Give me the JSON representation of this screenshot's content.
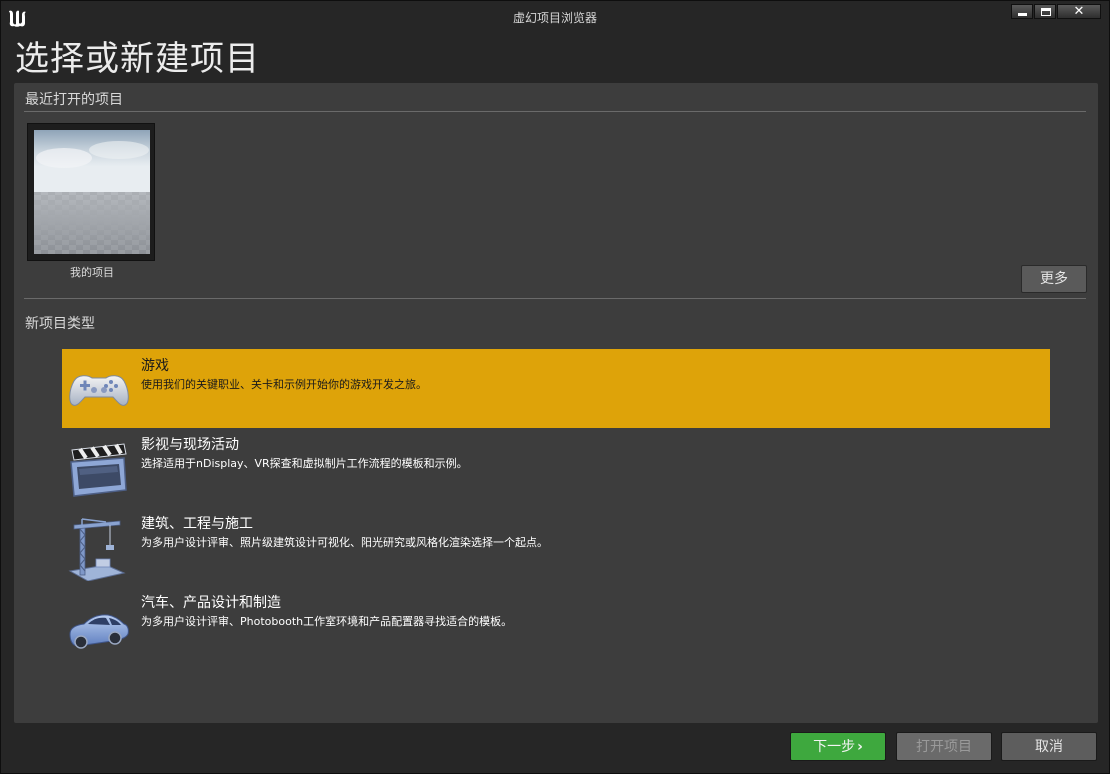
{
  "window": {
    "title": "虚幻项目浏览器",
    "logo_icon": "unreal-logo-icon",
    "controls": [
      "minimize",
      "maximize",
      "close"
    ]
  },
  "heading": "选择或新建项目",
  "recent": {
    "label": "最近打开的项目",
    "projects": [
      {
        "name": "我的项目"
      }
    ],
    "more_label": "更多"
  },
  "new_types": {
    "label": "新项目类型",
    "categories": [
      {
        "title": "游戏",
        "description": "使用我们的关键职业、关卡和示例开始你的游戏开发之旅。",
        "icon": "gamepad-icon",
        "selected": true
      },
      {
        "title": "影视与现场活动",
        "description": "选择适用于nDisplay、VR探查和虚拟制片工作流程的模板和示例。",
        "icon": "clapperboard-icon",
        "selected": false
      },
      {
        "title": "建筑、工程与施工",
        "description": "为多用户设计评审、照片级建筑设计可视化、阳光研究或风格化渲染选择一个起点。",
        "icon": "crane-icon",
        "selected": false
      },
      {
        "title": "汽车、产品设计和制造",
        "description": "为多用户设计评审、Photobooth工作室环境和产品配置器寻找适合的模板。",
        "icon": "car-icon",
        "selected": false
      }
    ]
  },
  "footer": {
    "next_label": "下一步",
    "next_icon": "chevron-right-icon",
    "open_label": "打开项目",
    "cancel_label": "取消"
  },
  "colors": {
    "selected_highlight": "#dea309",
    "next_button": "#3ea83e",
    "panel_bg": "#3d3d3d",
    "window_bg": "#262626"
  }
}
